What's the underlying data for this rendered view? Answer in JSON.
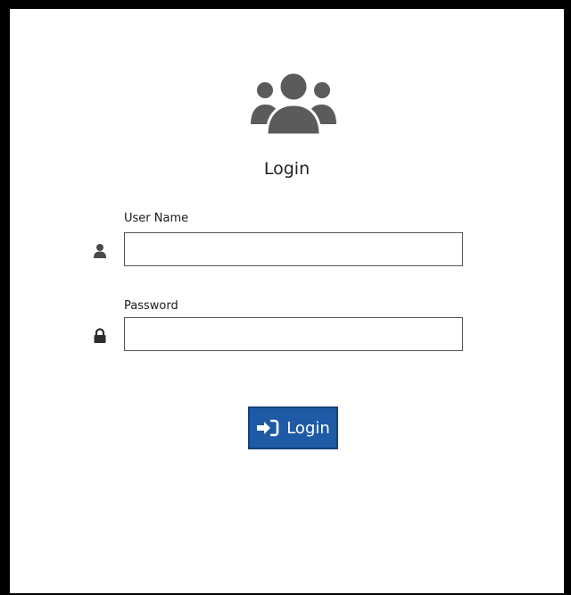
{
  "header": {
    "icon": "users-group-icon",
    "title": "Login"
  },
  "form": {
    "username": {
      "label": "User Name",
      "icon": "user-icon",
      "value": "",
      "placeholder": ""
    },
    "password": {
      "label": "Password",
      "icon": "lock-icon",
      "value": "",
      "placeholder": ""
    },
    "submit": {
      "label": "Login",
      "icon": "sign-in-icon"
    }
  },
  "colors": {
    "icon_gray": "#5b5b5b",
    "button_bg": "#1f5aa6",
    "button_border": "#173f7a",
    "frame_border": "#000000"
  }
}
